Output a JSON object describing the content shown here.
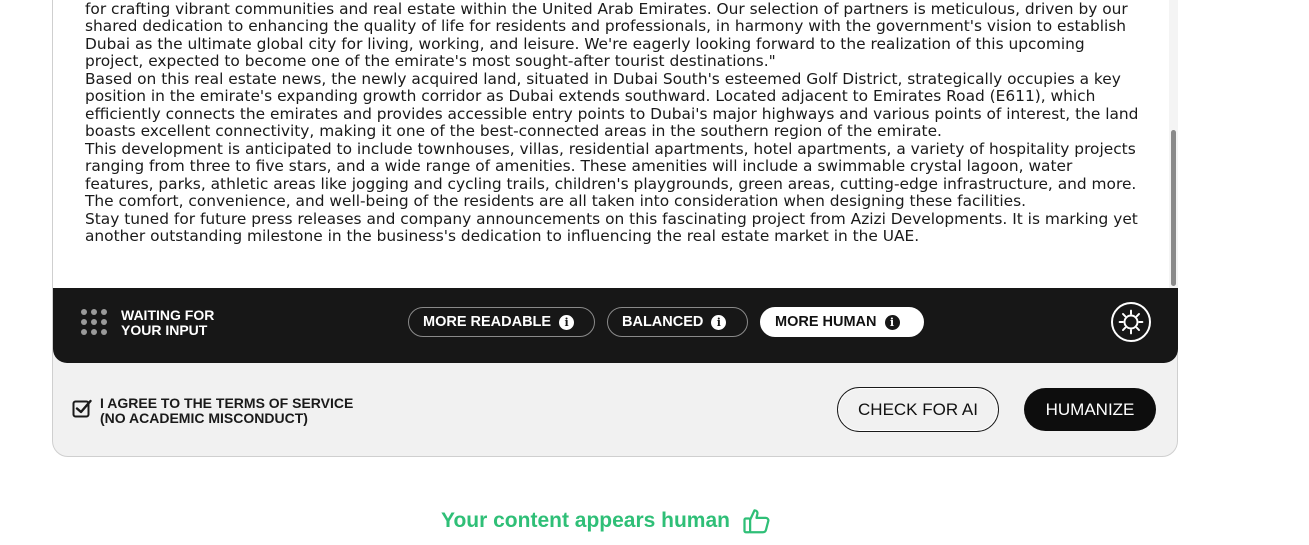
{
  "editor": {
    "paragraphs": [
      "According to the spokesperson for Dubai South, \"We're delighted to enter into this agreement with a well-respected developer renowned for crafting vibrant communities and real estate within the United Arab Emirates. Our selection of partners is meticulous, driven by our shared dedication to enhancing the quality of life for residents and professionals, in harmony with the government's vision to establish Dubai as the ultimate global city for living, working, and leisure. We're eagerly looking forward to the realization of this upcoming project, expected to become one of the emirate's most sought-after tourist destinations.\"",
      "Based on this real estate news, the newly acquired land, situated in Dubai South's esteemed Golf District, strategically occupies a key position in the emirate's expanding growth corridor as Dubai extends southward. Located adjacent to Emirates Road (E611), which efficiently connects the emirates and provides accessible entry points to Dubai's major highways and various points of interest, the land boasts excellent connectivity, making it one of the best-connected areas in the southern region of the emirate.",
      "This development is anticipated to include townhouses, villas, residential apartments, hotel apartments, a variety of hospitality projects ranging from three to five stars, and a wide range of amenities. These amenities will include a swimmable crystal lagoon, water features, parks, athletic areas like jogging and cycling trails, children's playgrounds, green areas, cutting-edge infrastructure, and more. The comfort, convenience, and well-being of the residents are all taken into consideration when designing these facilities.",
      "Stay tuned for future press releases and company announcements on this fascinating project from Azizi Developments. It is marking yet another outstanding milestone in the business's dedication to influencing the real estate market in the UAE."
    ]
  },
  "toolbar": {
    "status": "WAITING FOR YOUR INPUT",
    "modes": [
      {
        "label": "MORE READABLE",
        "active": false
      },
      {
        "label": "BALANCED",
        "active": false
      },
      {
        "label": "MORE HUMAN",
        "active": true
      }
    ],
    "settings_icon": "gear-icon"
  },
  "terms": {
    "label_line1": "I AGREE TO THE TERMS OF SERVICE",
    "label_line2": "(NO ACADEMIC MISCONDUCT)",
    "checked": true
  },
  "actions": {
    "check_label": "CHECK FOR AI",
    "humanize_label": "HUMANIZE"
  },
  "result": {
    "message": "Your content appears human",
    "icon": "thumbs-up-icon",
    "color": "#2fbf77"
  }
}
